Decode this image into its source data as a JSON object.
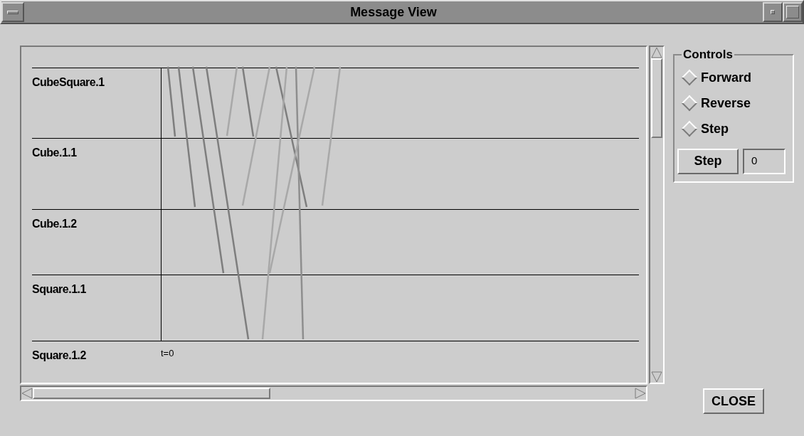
{
  "window": {
    "title": "Message View"
  },
  "timeline": {
    "rows": [
      {
        "label": "CubeSquare.1"
      },
      {
        "label": "Cube.1.1"
      },
      {
        "label": "Cube.1.2"
      },
      {
        "label": "Square.1.1"
      },
      {
        "label": "Square.1.2"
      }
    ],
    "time_label": "t=0"
  },
  "controls": {
    "title": "Controls",
    "modes": [
      {
        "label": "Forward",
        "selected": false
      },
      {
        "label": "Reverse",
        "selected": false
      },
      {
        "label": "Step",
        "selected": false
      }
    ],
    "step_button": "Step",
    "step_field": {
      "value": "0"
    }
  },
  "close_button": "CLOSE"
}
